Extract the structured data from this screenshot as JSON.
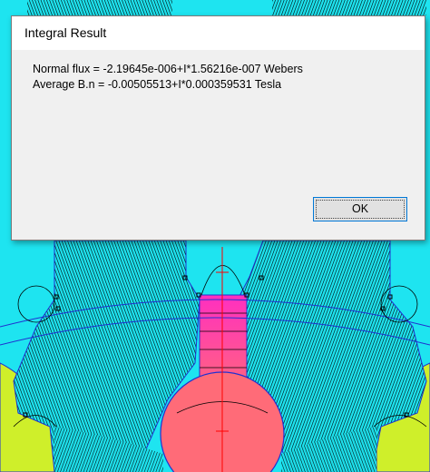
{
  "dialog": {
    "title": "Integral Result",
    "line1": "Normal flux = -2.19645e-006+I*1.56216e-007 Webers",
    "line2": "Average B.n = -0.00505513+I*0.000359531 Tesla",
    "ok_label": "OK"
  },
  "colors": {
    "background_cyan": "#1ee4f0",
    "region_yellow": "#cfef2a",
    "conductor_pink": "#ff6b78",
    "tooth_magenta": "#ff3fb0",
    "boundary_blue": "#2030d0",
    "contour_lines": "#000000",
    "cut_line_red": "#ff0000"
  }
}
